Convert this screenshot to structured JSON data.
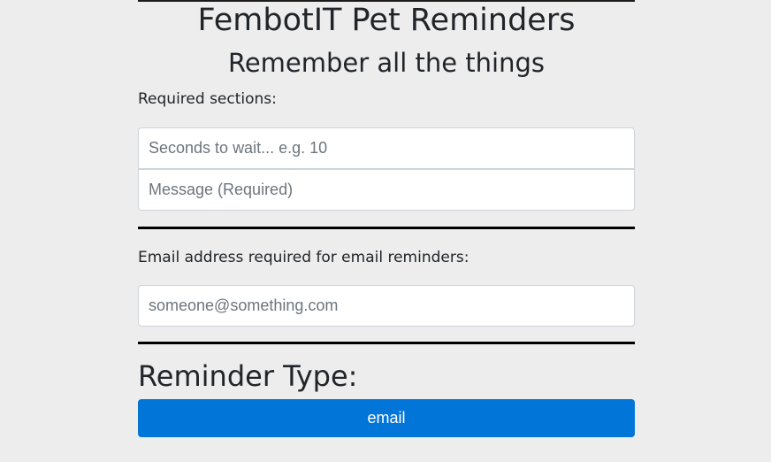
{
  "header": {
    "title": "FembotIT Pet Reminders",
    "subtitle": "Remember all the things"
  },
  "required_section": {
    "label": "Required sections:",
    "seconds_placeholder": "Seconds to wait... e.g. 10",
    "message_placeholder": "Message (Required)"
  },
  "email_section": {
    "label": "Email address required for email reminders:",
    "email_placeholder": "someone@something.com"
  },
  "reminder_type": {
    "heading": "Reminder Type:",
    "email_button_label": "email"
  },
  "colors": {
    "background": "#ededed",
    "button_primary": "#0275d8",
    "divider": "#000000"
  }
}
